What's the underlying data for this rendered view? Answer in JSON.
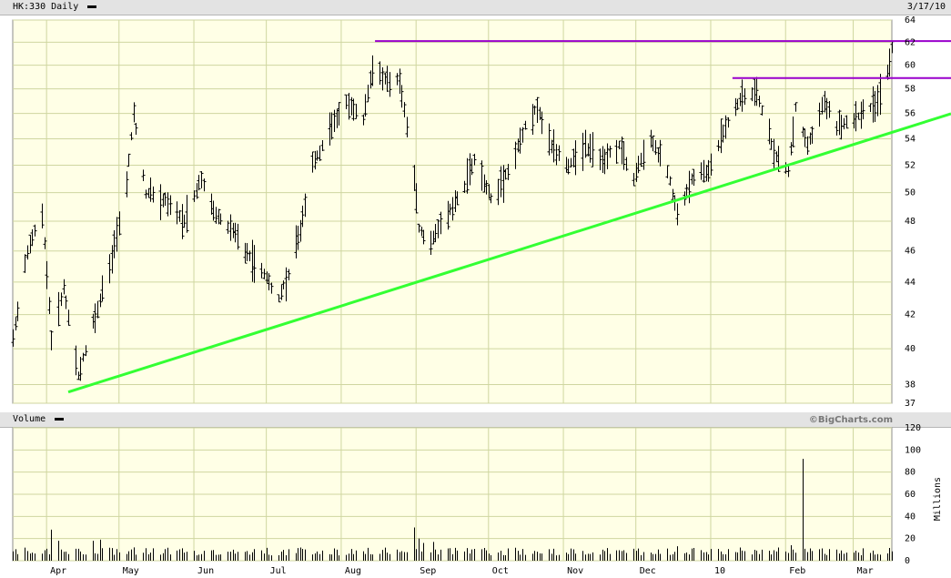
{
  "header": {
    "symbol_label": "HK:330 Daily",
    "date": "3/17/10"
  },
  "volume_header": {
    "label": "Volume",
    "credit": "©BigCharts.com"
  },
  "colors": {
    "plot_bg": "#ffffe6",
    "grid": "#cfd6a0",
    "bars": "#000000",
    "trendline": "#33ff33",
    "resistance": "#9900cc"
  },
  "chart_data": [
    {
      "type": "ohlc",
      "title": "HK:330 Daily",
      "scale": "log",
      "ylim": [
        37,
        64
      ],
      "y_ticks": [
        64,
        62,
        60,
        58,
        56,
        54,
        52,
        50,
        48,
        46,
        44,
        42,
        40,
        38,
        37
      ],
      "x_ticks": [
        "Apr",
        "May",
        "Jun",
        "Jul",
        "Aug",
        "Sep",
        "Oct",
        "Nov",
        "Dec",
        "10",
        "Feb",
        "Mar"
      ],
      "x_tick_dates": [
        "2009-04-01",
        "2009-05-01",
        "2009-06-01",
        "2009-07-01",
        "2009-08-01",
        "2009-09-01",
        "2009-10-01",
        "2009-11-01",
        "2009-12-01",
        "2010-01-01",
        "2010-02-01",
        "2010-03-01"
      ],
      "x_range": [
        "2009-03-18",
        "2010-03-17"
      ],
      "grid": true,
      "price_anchors": [
        [
          "2009-03-18",
          40.5
        ],
        [
          "2009-03-24",
          46.0
        ],
        [
          "2009-03-30",
          48.5
        ],
        [
          "2009-04-03",
          40.5
        ],
        [
          "2009-04-08",
          43.5
        ],
        [
          "2009-04-14",
          38.5
        ],
        [
          "2009-04-21",
          42.0
        ],
        [
          "2009-04-28",
          45.5
        ],
        [
          "2009-05-04",
          50.5
        ],
        [
          "2009-05-07",
          56.0
        ],
        [
          "2009-05-12",
          50.0
        ],
        [
          "2009-05-20",
          49.5
        ],
        [
          "2009-05-28",
          48.0
        ],
        [
          "2009-06-04",
          51.0
        ],
        [
          "2009-06-10",
          48.5
        ],
        [
          "2009-06-16",
          47.5
        ],
        [
          "2009-06-22",
          46.0
        ],
        [
          "2009-06-30",
          44.5
        ],
        [
          "2009-07-06",
          43.0
        ],
        [
          "2009-07-10",
          44.5
        ],
        [
          "2009-07-15",
          47.5
        ],
        [
          "2009-07-20",
          52.0
        ],
        [
          "2009-07-27",
          54.5
        ],
        [
          "2009-08-03",
          57.0
        ],
        [
          "2009-08-10",
          55.5
        ],
        [
          "2009-08-14",
          60.0
        ],
        [
          "2009-08-20",
          58.5
        ],
        [
          "2009-08-25",
          59.0
        ],
        [
          "2009-08-31",
          51.0
        ],
        [
          "2009-09-02",
          47.5
        ],
        [
          "2009-09-07",
          46.5
        ],
        [
          "2009-09-14",
          48.5
        ],
        [
          "2009-09-21",
          50.5
        ],
        [
          "2009-09-25",
          52.5
        ],
        [
          "2009-10-02",
          49.5
        ],
        [
          "2009-10-09",
          51.5
        ],
        [
          "2009-10-16",
          55.0
        ],
        [
          "2009-10-21",
          56.5
        ],
        [
          "2009-10-27",
          53.5
        ],
        [
          "2009-11-03",
          52.0
        ],
        [
          "2009-11-10",
          53.5
        ],
        [
          "2009-11-17",
          52.5
        ],
        [
          "2009-11-24",
          53.5
        ],
        [
          "2009-11-30",
          51.0
        ],
        [
          "2009-12-07",
          54.0
        ],
        [
          "2009-12-14",
          51.5
        ],
        [
          "2009-12-18",
          48.5
        ],
        [
          "2009-12-24",
          51.0
        ],
        [
          "2009-12-31",
          51.5
        ],
        [
          "2010-01-07",
          55.0
        ],
        [
          "2010-01-14",
          57.5
        ],
        [
          "2010-01-20",
          57.5
        ],
        [
          "2010-01-27",
          53.0
        ],
        [
          "2010-02-02",
          51.5
        ],
        [
          "2010-02-05",
          56.5
        ],
        [
          "2010-02-10",
          53.5
        ],
        [
          "2010-02-17",
          57.0
        ],
        [
          "2010-02-22",
          55.0
        ],
        [
          "2010-03-01",
          55.5
        ],
        [
          "2010-03-08",
          56.5
        ],
        [
          "2010-03-12",
          57.5
        ],
        [
          "2010-03-15",
          59.5
        ],
        [
          "2010-03-17",
          61.5
        ]
      ],
      "trendlines": [
        {
          "color": "#33ff33",
          "from": [
            "2009-04-10",
            37.6
          ],
          "to": [
            "2010-03-17",
            54.5
          ]
        }
      ],
      "horizontal_lines": [
        {
          "color": "#9900cc",
          "value": 62.1,
          "from": "2009-08-15"
        },
        {
          "color": "#9900cc",
          "value": 58.9,
          "from": "2010-01-10"
        }
      ]
    },
    {
      "type": "bar",
      "title": "Volume",
      "ylabel": "Millions",
      "ylim": [
        0,
        120
      ],
      "y_ticks": [
        120,
        100,
        80,
        60,
        40,
        20,
        0
      ],
      "baseline_volume": 8,
      "spikes": [
        [
          "2009-04-03",
          28
        ],
        [
          "2009-04-06",
          18
        ],
        [
          "2009-04-20",
          18
        ],
        [
          "2009-04-23",
          19
        ],
        [
          "2009-05-07",
          12
        ],
        [
          "2009-06-17",
          10
        ],
        [
          "2009-08-31",
          30
        ],
        [
          "2009-09-02",
          20
        ],
        [
          "2009-09-04",
          16
        ],
        [
          "2009-09-08",
          17
        ],
        [
          "2009-12-18",
          13
        ],
        [
          "2010-02-03",
          14
        ],
        [
          "2010-02-08",
          92
        ]
      ]
    }
  ]
}
